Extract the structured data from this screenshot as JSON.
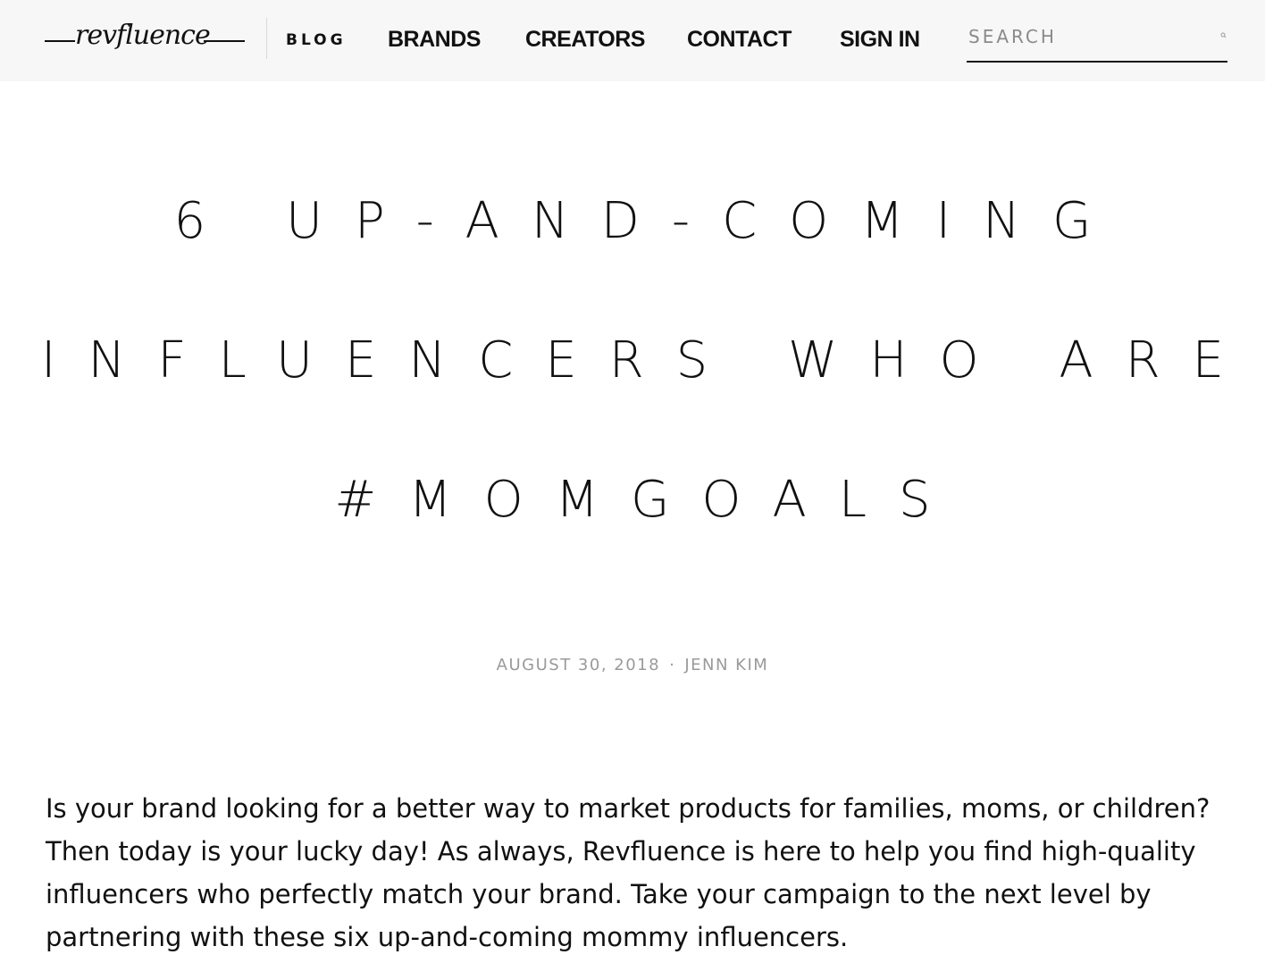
{
  "header": {
    "logo_text": "revfluence",
    "nav": {
      "blog": "BLOG",
      "brands": "BRANDS",
      "creators": "CREATORS",
      "contact": "CONTACT",
      "sign_in": "SIGN IN"
    },
    "search": {
      "placeholder": "SEARCH",
      "value": "",
      "icon": "search-icon"
    }
  },
  "post": {
    "title_lines": [
      "6 UP-AND-COMING",
      "INFLUENCERS WHO ARE",
      "#MOMGOALS"
    ],
    "date": "AUGUST 30, 2018",
    "separator": "·",
    "author": "JENN KIM",
    "intro": "Is your brand looking for a better way to market products for families, moms, or children? Then today is your lucky day! As always, Revfluence is here to help you find high-quality influencers who perfectly match your brand. Take your campaign to the next level by partnering with these six up-and-coming mommy influencers."
  },
  "colors": {
    "header_bg": "#f7f7f7",
    "text": "#111111",
    "meta": "#9a9a9a"
  }
}
